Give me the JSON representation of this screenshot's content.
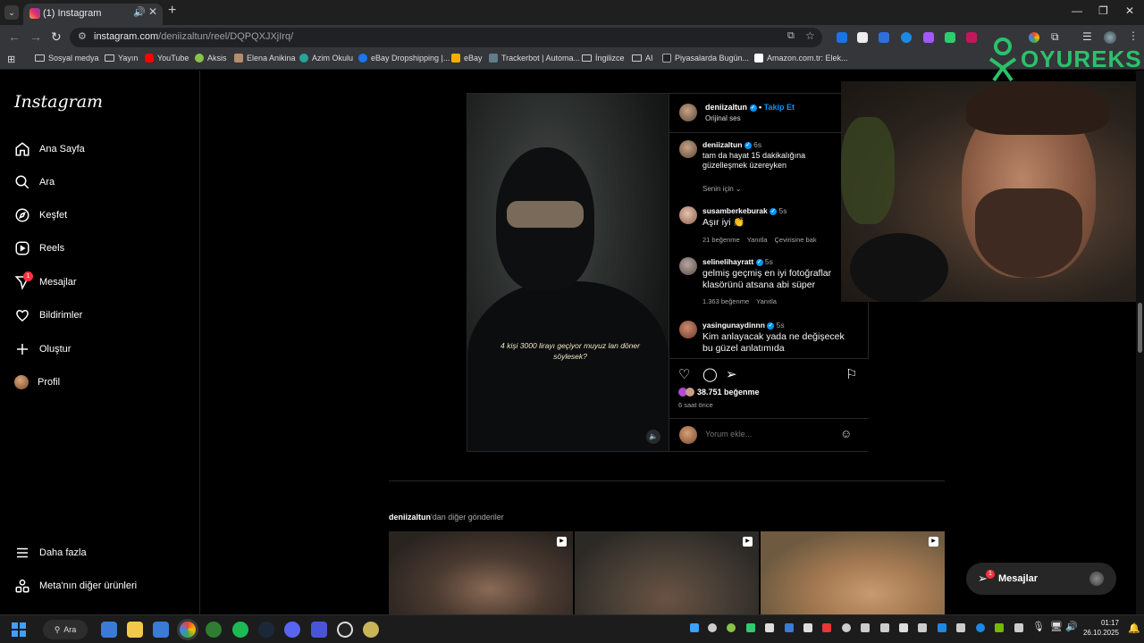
{
  "browser": {
    "tab_title": "(1) Instagram",
    "url_host": "instagram.com",
    "url_path": "/deniizaltun/reel/DQPQXJXjIrq/",
    "bookmarks": [
      "Sosyal medya",
      "Yayın",
      "YouTube",
      "Aksis",
      "Elena Anikina",
      "Azim Okulu",
      "eBay Dropshipping |...",
      "eBay",
      "Trackerbot | Automa...",
      "İngilizce",
      "AI",
      "Piyasalarda Bugün...",
      "Amazon.com.tr: Elek..."
    ]
  },
  "sidebar": {
    "logo": "Instagram",
    "items": [
      {
        "label": "Ana Sayfa",
        "icon": "home-icon"
      },
      {
        "label": "Ara",
        "icon": "search-icon"
      },
      {
        "label": "Keşfet",
        "icon": "compass-icon"
      },
      {
        "label": "Reels",
        "icon": "reels-icon"
      },
      {
        "label": "Mesajlar",
        "icon": "messenger-icon",
        "badge": "1"
      },
      {
        "label": "Bildirimler",
        "icon": "heart-icon"
      },
      {
        "label": "Oluştur",
        "icon": "plus-icon"
      },
      {
        "label": "Profil",
        "icon": "avatar"
      }
    ],
    "bottom": [
      {
        "label": "Daha fazla",
        "icon": "menu-icon"
      },
      {
        "label": "Meta'nın diğer ürünleri",
        "icon": "meta-apps-icon"
      }
    ]
  },
  "post": {
    "video_caption": "4 kişi 3000 lirayı geçiyor muyuz lan döner söylesek?",
    "author": "deniizaltun",
    "follow": "Takip Et",
    "audio": "Orijinal ses",
    "caption": {
      "user": "deniizaltun",
      "time": "6s",
      "text": "tam da hayat 15 dakikalığına güzelleşmek üzereyken",
      "translate": "Senin için"
    },
    "comments": [
      {
        "user": "susamberkeburak",
        "time": "5s",
        "text": "Aşır iyi 👏",
        "likes": "21 beğenme",
        "reply": "Yanıtla",
        "translate": "Çevirisine bak"
      },
      {
        "user": "selinelihayratt",
        "time": "5s",
        "text": "gelmiş geçmiş en iyi fotoğraflar klasörünü atsana abi süper",
        "likes": "1.363 beğenme",
        "reply": "Yanıtla"
      },
      {
        "user": "yasingunaydinnn",
        "time": "5s",
        "text": "Kim anlayacak yada ne değişecek bu güzel anlatımıda"
      }
    ],
    "like_count": "38.751 beğenme",
    "time_ago": "6 saat önce",
    "comment_placeholder": "Yorum ekle..."
  },
  "more_posts": {
    "user": "deniizaltun",
    "suffix": "'dan diğer gönderiler"
  },
  "messages_pill": {
    "label": "Mesajlar",
    "badge": "1"
  },
  "overlay": {
    "brand": "OYUREKS"
  },
  "taskbar": {
    "search": "Ara",
    "time": "01:17",
    "date": "26.10.2025"
  },
  "colors": {
    "accent_blue": "#0095f6",
    "badge_red": "#ff3040",
    "brand_green": "#29c26a"
  }
}
